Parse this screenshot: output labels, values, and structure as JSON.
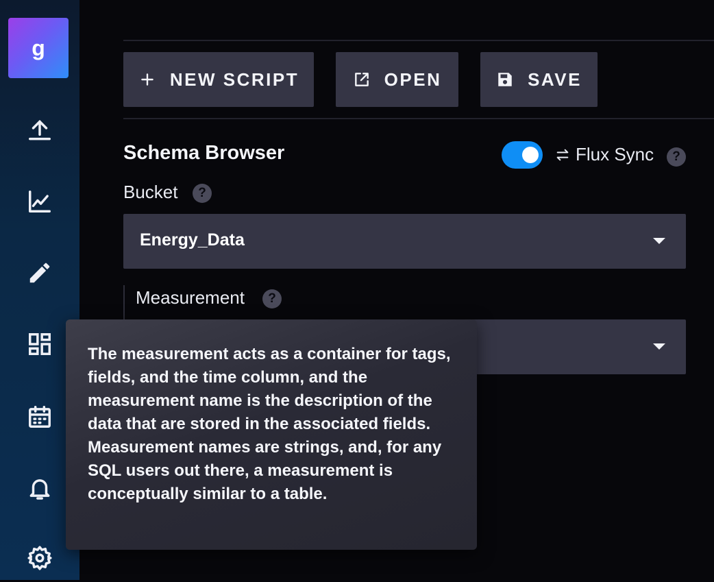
{
  "sidebar": {
    "org_initial": "g",
    "icons": [
      "upload-icon",
      "graph-icon",
      "pencil-icon",
      "dashboards-icon",
      "calendar-icon",
      "bell-icon",
      "gear-icon"
    ]
  },
  "toolbar": {
    "new_script_label": "NEW SCRIPT",
    "open_label": "OPEN",
    "save_label": "SAVE"
  },
  "schema_browser": {
    "title": "Schema Browser",
    "flux_sync_label": "Flux Sync",
    "flux_sync_on": true,
    "bucket_label": "Bucket",
    "bucket_value": "Energy_Data",
    "measurement_label": "Measurement"
  },
  "help_glyph": "?",
  "tooltip": {
    "text": "The measurement acts as a container for tags, fields, and the time column, and the measurement name is the description of the data that are stored in the associated fields. Measurement names are strings, and, for any SQL users out there, a measurement is conceptually similar to a table."
  },
  "colors": {
    "accent": "#0f8ef5",
    "button_bg": "#353545",
    "background": "#07070b"
  }
}
